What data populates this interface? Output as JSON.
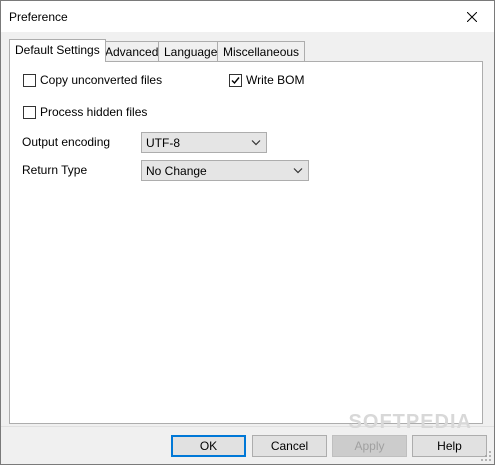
{
  "window": {
    "title": "Preference"
  },
  "tabs": [
    {
      "label": "Default Settings",
      "active": true
    },
    {
      "label": "Advanced",
      "active": false
    },
    {
      "label": "Language",
      "active": false
    },
    {
      "label": "Miscellaneous",
      "active": false
    }
  ],
  "options": {
    "copy_unconverted": {
      "label": "Copy unconverted files",
      "checked": false
    },
    "write_bom": {
      "label": "Write BOM",
      "checked": true
    },
    "process_hidden": {
      "label": "Process hidden files",
      "checked": false
    }
  },
  "fields": {
    "output_encoding": {
      "label": "Output encoding",
      "value": "UTF-8"
    },
    "return_type": {
      "label": "Return Type",
      "value": "No Change"
    }
  },
  "buttons": {
    "ok": "OK",
    "cancel": "Cancel",
    "apply": "Apply",
    "help": "Help"
  },
  "watermark": "SOFTPEDIA",
  "colors": {
    "accent": "#0078d7"
  }
}
